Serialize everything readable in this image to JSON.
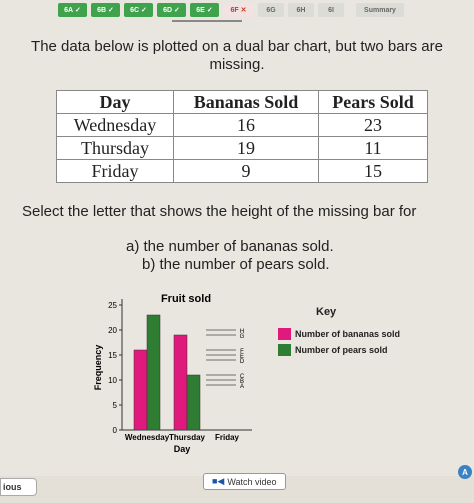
{
  "tabs": [
    {
      "label": "6A",
      "status": "correct"
    },
    {
      "label": "6B",
      "status": "correct"
    },
    {
      "label": "6C",
      "status": "correct"
    },
    {
      "label": "6D",
      "status": "correct"
    },
    {
      "label": "6E",
      "status": "correct"
    },
    {
      "label": "6F",
      "status": "incorrect"
    },
    {
      "label": "6G",
      "status": "todo"
    },
    {
      "label": "6H",
      "status": "todo"
    },
    {
      "label": "6I",
      "status": "todo"
    },
    {
      "label": "Summary",
      "status": "todo"
    }
  ],
  "question": {
    "line1": "The data below is plotted on a dual bar chart, but two bars are",
    "line2": "missing."
  },
  "table": {
    "headers": [
      "Day",
      "Bananas Sold",
      "Pears Sold"
    ],
    "rows": [
      [
        "Wednesday",
        "16",
        "23"
      ],
      [
        "Thursday",
        "19",
        "11"
      ],
      [
        "Friday",
        "9",
        "15"
      ]
    ]
  },
  "prompt": "Select the letter that shows the height of the missing bar for",
  "parts": {
    "a": "a) the number of bananas sold.",
    "b": "b) the number of pears sold."
  },
  "chart_data": {
    "type": "bar",
    "title": "Fruit sold",
    "xlabel": "Day",
    "ylabel": "Frequency",
    "categories": [
      "Wednesday",
      "Thursday",
      "Friday"
    ],
    "series": [
      {
        "name": "Number of bananas sold",
        "values": [
          16,
          19,
          null
        ],
        "color": "#e0197d"
      },
      {
        "name": "Number of pears sold",
        "values": [
          23,
          11,
          null
        ],
        "color": "#2f7d32"
      }
    ],
    "yticks": [
      "0",
      "5",
      "10",
      "15",
      "20",
      "25"
    ],
    "ylim": [
      0,
      25
    ],
    "answer_markers": [
      "A",
      "B",
      "C",
      "D",
      "E",
      "F",
      "G",
      "H"
    ],
    "marker_values": [
      9,
      10,
      11,
      14,
      15,
      16,
      19,
      20
    ],
    "legend_title": "Key"
  },
  "footer": {
    "previous": "ious",
    "watch_video": "Watch video",
    "avatar": "A"
  }
}
